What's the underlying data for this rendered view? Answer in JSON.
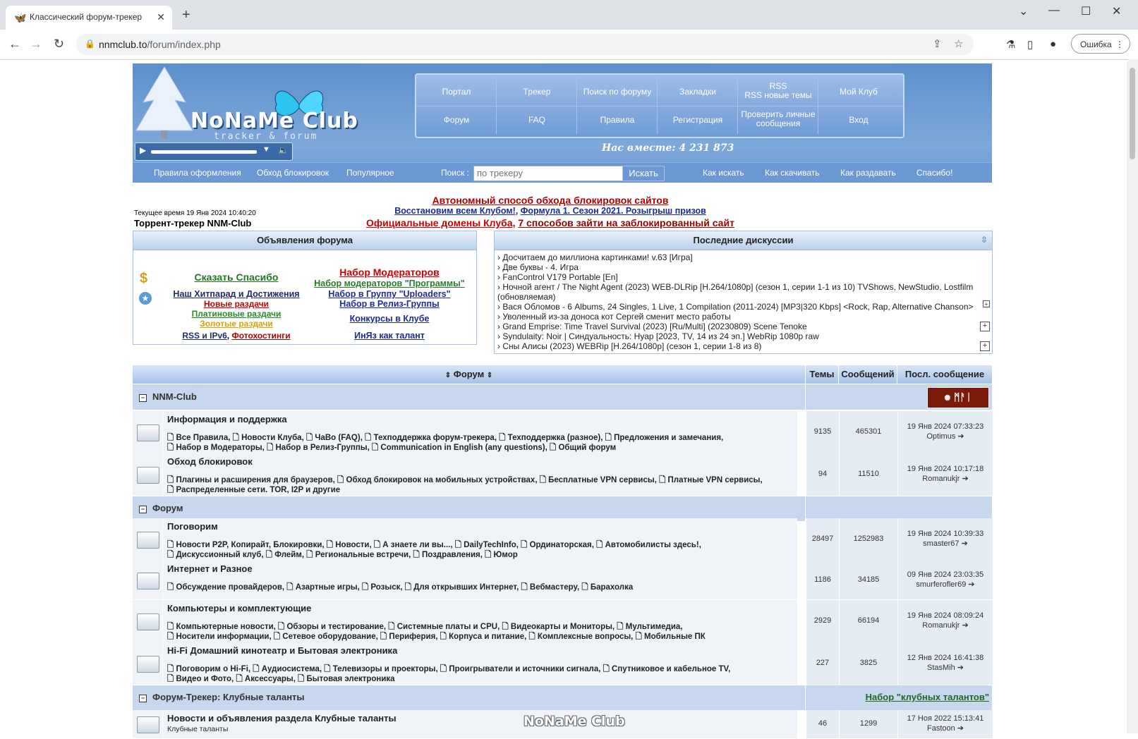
{
  "browser": {
    "tab_title": "Классический форум-трекер",
    "url_host": "nnmclub.to",
    "url_path": "/forum/index.php",
    "error_button": "Ошибка"
  },
  "header": {
    "logo": "NoNaMe Club",
    "logo_sub": "tracker & forum",
    "menu_row1": [
      "Портал",
      "Трекер",
      "Поиск по форуму",
      "Закладки",
      "RSS\nRSS новые темы",
      "Мой Клуб"
    ],
    "menu_row2": [
      "Форум",
      "FAQ",
      "Правила",
      "Регистрация",
      "Проверить личные\nсообщения",
      "Вход"
    ],
    "together": "Нас вместе: 4 231 873",
    "subnav_left": [
      "Правила оформления",
      "Обход блокировок",
      "Популярное"
    ],
    "search_label": "Поиск :",
    "search_placeholder": "по трекеру",
    "search_button": "Искать",
    "subnav_right": [
      "Как искать",
      "Как скачивать",
      "Как раздавать",
      "Спасибо!"
    ]
  },
  "status": {
    "current_time": "Текущее время 19 Янв 2024 10:40:20",
    "tracker_title": "Торрент-трекер NNM-Club"
  },
  "announcements": {
    "line1": "Автономный способ обхода блокировок сайтов",
    "line2a": "Восстановим всем Клубом!",
    "line2b": "Формула 1. Сезон 2021. Розыгрыш призов",
    "line3a": "Официальные домены Клуба",
    "line3b": "7 способов зайти на заблокированный сайт"
  },
  "forum_ads": {
    "title": "Объявления форума",
    "say_thanks": "Сказать Спасибо",
    "hitparade": "Наш Хитпарад и Достижения",
    "new": "Новые раздачи",
    "platinum": "Платиновые раздачи",
    "gold": "Золотые раздачи",
    "rss": "RSS и IPv6",
    "photo": "Фотохостинги",
    "mods": "Набор Модераторов",
    "mods_prog": "Набор модераторов \"Программы\"",
    "uploaders": "Набор в Группу \"Uploaders\"",
    "release": "Набор в Релиз-Группы",
    "contests": "Конкурсы в Клубе",
    "inyaz": "ИнЯз как талант"
  },
  "discussions": {
    "title": "Последние дискуссии",
    "items": [
      "› Досчитаем до миллиона картинками! v.63 [Игра]",
      "› Две буквы - 4. Игра",
      "› FanControl V179 Portable [En]",
      "› Ночной агент / The Night Agent (2023) WEB-DLRip [H.264/1080p] (сезон 1, серии 1-1 из 10) TVShows, NewStudio, Lostfilm",
      "   (обновляемая)",
      "› Вася Обломов - 6 Albums, 24 Singles, 1 Live, 1 Compilation (2011-2024) [MP3|320 Kbps] <Rock, Rap, Alternative Chanson>",
      "› Уволенный из-за доноса кот Сергей сменит место работы",
      "› Grand Emprise: Time Travel Survival (2023) [Ru/Multi] (20230809) Scene Tenoke",
      "› Syndulaity: Noir | Синдуальность: Нуар [2023, TV, 14 из 24 эп.] WebRip 1080p raw",
      "› Сны Алисы (2023) WEBRip [H.264/1080p] (сезон 1, серии 1-8 из 8)"
    ]
  },
  "table": {
    "col_forum": "Форум",
    "col_topics": "Темы",
    "col_posts": "Сообщений",
    "col_last": "Посл. сообщение"
  },
  "categories": [
    {
      "name": "NNM-Club"
    },
    {
      "name": "Форум"
    },
    {
      "name": "Форум-Трекер: Клубные таланты",
      "right_link": "Набор \"клубных талантов\""
    }
  ],
  "forums": [
    {
      "title": "Информация и поддержка",
      "line1": "🗋 Все Правила, 🗋 Новости Клуба, 🗋 ЧаВо (FAQ), 🗋 Техподдержка форум-трекера, 🗋 Техподдержка (разное), 🗋 Предложения и замечания,",
      "line2": "🗋 Набор в Модераторы, 🗋 Набор в Релиз-Группы, 🗋 Communication in English (any questions), 🗋 Общий форум",
      "topics": "9135",
      "posts": "465301",
      "date": "19 Янв 2024 07:33:23",
      "user": "Optimus"
    },
    {
      "title": "Обход блокировок",
      "line1": "🗋 Плагины и расширения для браузеров, 🗋 Обход блокировок на мобильных устройствах, 🗋 Бесплатные VPN сервисы, 🗋 Платные VPN сервисы,",
      "line2": "🗋 Распределенные сети. TOR, I2P и другие",
      "topics": "94",
      "posts": "11510",
      "date": "19 Янв 2024 10:17:18",
      "user": "Romanukjr"
    },
    {
      "title": "Поговорим",
      "line1": "🗋 Новости P2P, Копирайт, Блокировки, 🗋 Новости, 🗋 А знаете ли вы..., 🗋 DailyTechInfo, 🗋 Ординаторская, 🗋 Автомобилисты здесь!,",
      "line2": "🗋 Дискуссионный клуб, 🗋 Флейм, 🗋 Региональные встречи, 🗋 Поздравления, 🗋 Юмор",
      "topics": "28497",
      "posts": "1252983",
      "date": "19 Янв 2024 10:39:33",
      "user": "smaster67"
    },
    {
      "title": "Интернет и Разное",
      "line1": "🗋 Обсуждение провайдеров, 🗋 Азартные игры, 🗋 Розыск, 🗋 Для открывших Интернет, 🗋 Вебмастеру, 🗋 Барахолка",
      "line2": "",
      "topics": "1186",
      "posts": "34185",
      "date": "09 Янв 2024 23:03:35",
      "user": "smurferofler69"
    },
    {
      "title": "Компьютеры и комплектующие",
      "line1": "🗋 Компьютерные новости, 🗋 Обзоры и тестирование, 🗋 Системные платы и CPU, 🗋 Видеокарты и Мониторы, 🗋 Мультимедиа,",
      "line2": "🗋 Носители информации, 🗋 Сетевое оборудование, 🗋 Периферия, 🗋 Корпуса и питание, 🗋 Комплексные вопросы, 🗋 Мобильные ПК",
      "topics": "2929",
      "posts": "66194",
      "date": "19 Янв 2024 08:09:24",
      "user": "Romanukjr"
    },
    {
      "title": "Hi-Fi Домашний кинотеатр и Бытовая электроника",
      "line1": "🗋 Поговорим о Hi-Fi, 🗋 Аудиосистема, 🗋 Телевизоры и проекторы, 🗋 Проигрыватели и источники сигнала, 🗋 Спутниковое и кабельное TV,",
      "line2": "🗋 Видео и Фото, 🗋 Аксессуары, 🗋 Бытовая электроника",
      "topics": "227",
      "posts": "3825",
      "date": "12 Янв 2024 16:41:38",
      "user": "StasMih"
    },
    {
      "title": "Новости и объявления раздела Клубные таланты",
      "line1": "Клубные таланты",
      "line2": "",
      "topics": "46",
      "posts": "1299",
      "date": "17 Ноя 2022 15:13:41",
      "user": "Fastoon"
    }
  ],
  "watermark": "NoNaMe Club"
}
